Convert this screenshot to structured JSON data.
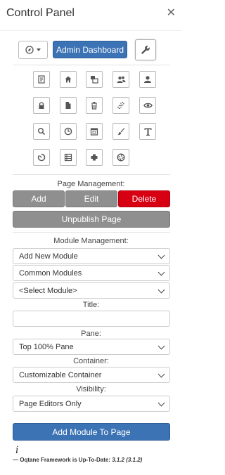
{
  "header": {
    "title": "Control Panel",
    "close_glyph": "✕"
  },
  "toolbar": {
    "page_actions_icon": "compass-icon",
    "admin_label": "Admin Dashboard",
    "settings_icon": "wrench-icon"
  },
  "icon_grid": [
    "site-settings-icon",
    "home-icon",
    "pages-icon",
    "users-icon",
    "profile-icon",
    "lock-icon",
    "file-icon",
    "recycle-bin-icon",
    "link-icon",
    "eye-icon",
    "search-icon",
    "clock-icon",
    "calendar-icon",
    "brush-icon",
    "text-icon",
    "timer-icon",
    "list-icon",
    "plus-box-icon",
    "aperture-icon"
  ],
  "page_management": {
    "label": "Page Management:",
    "add": "Add",
    "edit": "Edit",
    "delete": "Delete",
    "unpublish": "Unpublish Page"
  },
  "module_management": {
    "label": "Module Management:",
    "action_select": "Add New Module",
    "category_select": "Common Modules",
    "module_select": "<Select Module>",
    "title_label": "Title:",
    "title_value": "",
    "pane_label": "Pane:",
    "pane_select": "Top 100% Pane",
    "container_label": "Container:",
    "container_select": "Customizable Container",
    "visibility_label": "Visibility:",
    "visibility_select": "Page Editors Only",
    "add_button": "Add Module To Page"
  },
  "footer": {
    "info_glyph": "i",
    "status_text": "— Oqtane Framework is Up-To-Date: ",
    "version": "3.1.2 (3.1.2)"
  },
  "colors": {
    "primary": "#3b73b5",
    "danger": "#d70012",
    "secondary": "#8f8f8f"
  }
}
